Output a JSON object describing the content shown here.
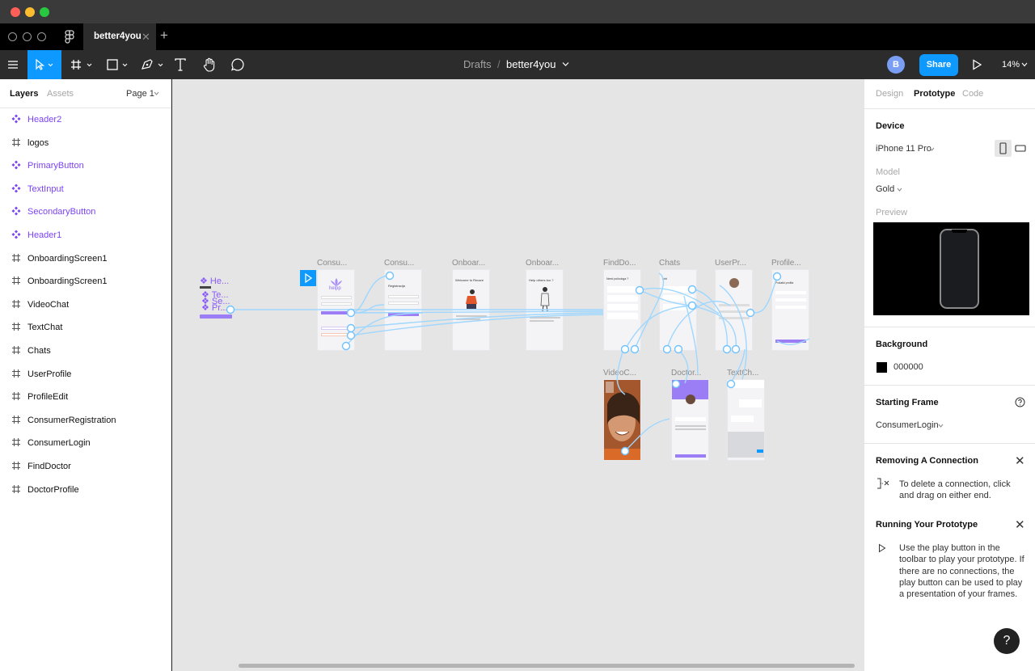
{
  "window": {
    "tab_title": "better4you"
  },
  "toolbar": {
    "breadcrumb_folder": "Drafts",
    "breadcrumb_separator": "/",
    "file_name": "better4you",
    "avatar_initial": "B",
    "share_label": "Share",
    "zoom": "14%",
    "accent_color": "#0d99ff"
  },
  "left_panel": {
    "tabs": [
      "Layers",
      "Assets"
    ],
    "page_selector": "Page 1",
    "layers": [
      {
        "name": "Header2",
        "kind": "component"
      },
      {
        "name": "logos",
        "kind": "frame"
      },
      {
        "name": "PrimaryButton",
        "kind": "component"
      },
      {
        "name": "TextInput",
        "kind": "component"
      },
      {
        "name": "SecondaryButton",
        "kind": "component"
      },
      {
        "name": "Header1",
        "kind": "component"
      },
      {
        "name": "OnboardingScreen1",
        "kind": "frame"
      },
      {
        "name": "OnboardingScreen1",
        "kind": "frame"
      },
      {
        "name": "VideoChat",
        "kind": "frame"
      },
      {
        "name": "TextChat",
        "kind": "frame"
      },
      {
        "name": "Chats",
        "kind": "frame"
      },
      {
        "name": "UserProfile",
        "kind": "frame"
      },
      {
        "name": "ProfileEdit",
        "kind": "frame"
      },
      {
        "name": "ConsumerRegistration",
        "kind": "frame"
      },
      {
        "name": "ConsumerLogin",
        "kind": "frame"
      },
      {
        "name": "FindDoctor",
        "kind": "frame"
      },
      {
        "name": "DoctorProfile",
        "kind": "frame"
      }
    ]
  },
  "canvas": {
    "frame_labels": [
      "Consu...",
      "Consu...",
      "Onboar...",
      "Onboar...",
      "FindDo...",
      "Chats",
      "UserPr...",
      "Profile...",
      "VideoC...",
      "Doctor...",
      "TextCh..."
    ],
    "components_group_labels": [
      "He...",
      "Te...",
      "Se...",
      "Pr..."
    ],
    "frame_texts": {
      "logo": "helpp",
      "registration": "Registracija",
      "welcome": "Welcome to Recare",
      "help_others": "Help others too ?",
      "find_doctor": "Need psihologa ?",
      "chats": "Inbt",
      "profile_edit": "Podatki profila"
    },
    "connection_color": "#9fd7ff",
    "brand_purple": "#9b7df5"
  },
  "right_panel": {
    "tabs": [
      "Design",
      "Prototype",
      "Code"
    ],
    "active_tab": "Prototype",
    "device_heading": "Device",
    "device_value": "iPhone 11 Pro",
    "model_label": "Model",
    "model_value": "Gold",
    "preview_label": "Preview",
    "background_heading": "Background",
    "background_value": "000000",
    "starting_frame_heading": "Starting Frame",
    "starting_frame_value": "ConsumerLogin",
    "removing_heading": "Removing A Connection",
    "removing_text": "To delete a connection, click and drag on either end.",
    "running_heading": "Running Your Prototype",
    "running_text": "Use the play button in the toolbar to play your prototype. If there are no connections, the play button can be used to play a presentation of your frames.",
    "help_label": "?"
  }
}
